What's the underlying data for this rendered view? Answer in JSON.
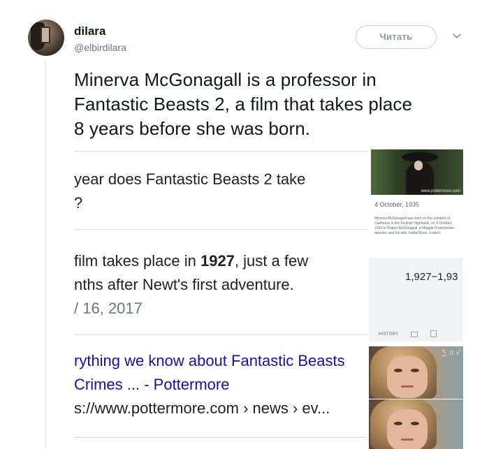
{
  "tweet": {
    "author_name": "dilara",
    "handle": "@elbirdilara",
    "follow_label": "Читать",
    "text": "Minerva McGonagall is a professor in\nFantastic Beasts 2, a film that takes place\n8 years before she was born."
  },
  "screenshot": {
    "question_line1": " year does Fantastic Beasts 2 take",
    "question_line2": "?",
    "answer_pre": " film takes place in ",
    "answer_bold": "1927",
    "answer_post": ", just a few",
    "answer_line2": "nths after Newt's first adventure.",
    "answer_date": "/ 16, 2017",
    "link_line1": "rything we know about Fantastic Beasts",
    "link_line2": " Crimes ... - Pottermore",
    "url_line": "s://www.pottermore.com › news › ev...",
    "side_image_caption": "www.pottermore.com",
    "side_date": "4 October, 1935",
    "side_body": "Minerva McGonagall was born on the outskirts of Caithness in the Scottish Highlands, on 4 October, 1935 to Robert McGonagall, a Muggle Presbyterian minister, and his wife, Isobel Ross, a witch.",
    "calc_value": "1,927−1,93",
    "history_label": "HISTORY",
    "math_symbols": "∑ π √"
  }
}
